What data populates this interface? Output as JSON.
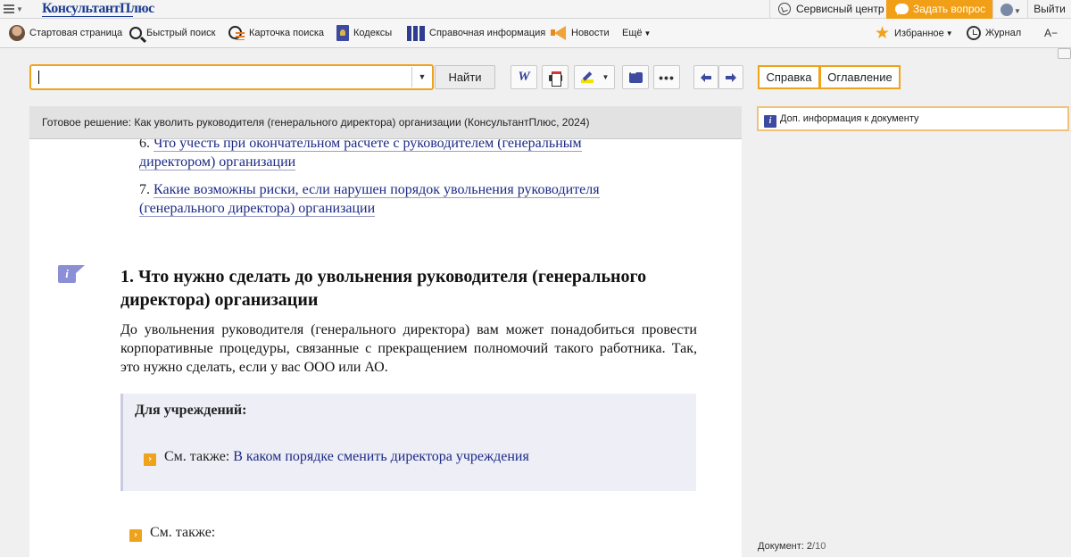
{
  "topbar": {
    "brand": "КонсультантПлюс",
    "service_center": "Сервисный центр",
    "ask_question": "Задать вопрос",
    "logout": "Выйти"
  },
  "nav": {
    "items": [
      {
        "label": "Стартовая страница",
        "icon": "home-avatar-icon"
      },
      {
        "label": "Быстрый поиск",
        "icon": "search-icon"
      },
      {
        "label": "Карточка поиска",
        "icon": "search-card-icon"
      },
      {
        "label": "Кодексы",
        "icon": "codex-book-icon"
      },
      {
        "label": "Справочная информация",
        "icon": "reference-binders-icon"
      },
      {
        "label": "Новости",
        "icon": "megaphone-icon"
      },
      {
        "label": "Ещё"
      }
    ],
    "favorites": "Избранное",
    "journal": "Журнал",
    "font_size": "A−"
  },
  "search": {
    "value": "",
    "find_label": "Найти"
  },
  "right_tabs": {
    "help": "Справка",
    "contents": "Оглавление"
  },
  "document": {
    "title": "Готовое решение: Как уволить руководителя (генерального директора) организации (КонсультантПлюс, 2024)",
    "toc": [
      {
        "num": "6.",
        "text": "Что учесть при окончательном расчете с руководителем (генеральным директором) организации"
      },
      {
        "num": "7.",
        "text": "Какие возможны риски, если нарушен порядок увольнения руководителя (генерального директора) организации"
      }
    ],
    "heading": "1. Что нужно сделать до увольнения руководителя (генерального директора) организации",
    "paragraph": "До увольнения руководителя (генерального директора) вам может понадобиться провести корпоративные процедуры, связанные с прекращением полномочий такого работника. Так, это нужно сделать, если у вас ООО или АО.",
    "institutions": {
      "title": "Для учреждений:",
      "see_also_prefix": "См. также:",
      "link": "В каком порядке сменить директора учреждения"
    },
    "see_also": "См. также:"
  },
  "side": {
    "info_label": "Доп. информация к документу",
    "doc_count_label": "Документ:",
    "doc_current": "2",
    "doc_total": "10"
  }
}
